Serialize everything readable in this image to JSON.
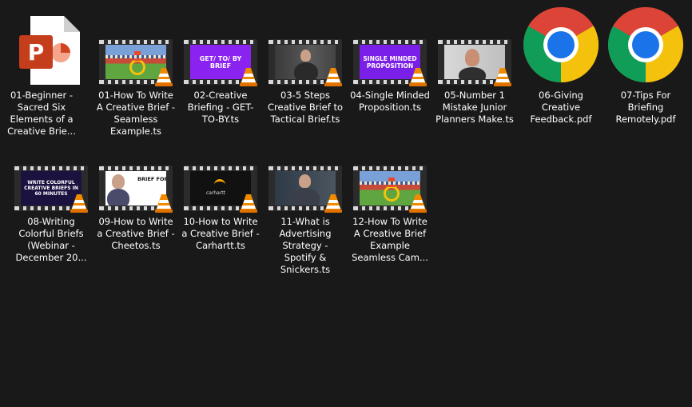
{
  "files": [
    {
      "label": "01-Beginner - Sacred Six Elements of a Creative Brie...",
      "icon": "powerpoint-icon"
    },
    {
      "label": "01-How To Write A Creative Brief - Seamless Example.ts",
      "icon": "video-thumbnail"
    },
    {
      "label": "02-Creative Briefing - GET-TO-BY.ts",
      "icon": "video-thumbnail",
      "thumb_text": "GET/ TO/ BY BRIEF",
      "thumb_color": "#8a22f0"
    },
    {
      "label": "03-5 Steps Creative Brief to Tactical Brief.ts",
      "icon": "video-thumbnail"
    },
    {
      "label": "04-Single Minded Proposition.ts",
      "icon": "video-thumbnail",
      "thumb_text": "SINGLE MINDED PROPOSITION",
      "thumb_color": "#7a1fe8"
    },
    {
      "label": "05-Number 1 Mistake Junior Planners Make.ts",
      "icon": "video-thumbnail"
    },
    {
      "label": "06-Giving Creative Feedback.pdf",
      "icon": "chrome-icon"
    },
    {
      "label": "07-Tips For Briefing Remotely.pdf",
      "icon": "chrome-icon"
    },
    {
      "label": "08-Writing Colorful Briefs (Webinar - December 20...",
      "icon": "video-thumbnail",
      "thumb_text": "WRITE COLORFUL CREATIVE BRIEFS IN 60 MINUTES",
      "thumb_color": "#1c1240"
    },
    {
      "label": "09-How to Write a Creative Brief - Cheetos.ts",
      "icon": "video-thumbnail",
      "thumb_text": "BRIEF FORMU"
    },
    {
      "label": "10-How to Write a Creative Brief - Carhartt.ts",
      "icon": "video-thumbnail",
      "thumb_text": "carhartt"
    },
    {
      "label": "11-What is Advertising Strategy - Spotify & Snickers.ts",
      "icon": "video-thumbnail"
    },
    {
      "label": "12-How To Write A Creative Brief Example Seamless Cam...",
      "icon": "video-thumbnail"
    }
  ],
  "colors": {
    "background": "#191919",
    "text": "#ffffff",
    "vlc_orange": "#f28a00",
    "powerpoint_red": "#d04423",
    "chrome_red": "#db4437",
    "chrome_yellow": "#f4c20d",
    "chrome_green": "#0f9d58",
    "chrome_blue": "#1a73e8"
  }
}
